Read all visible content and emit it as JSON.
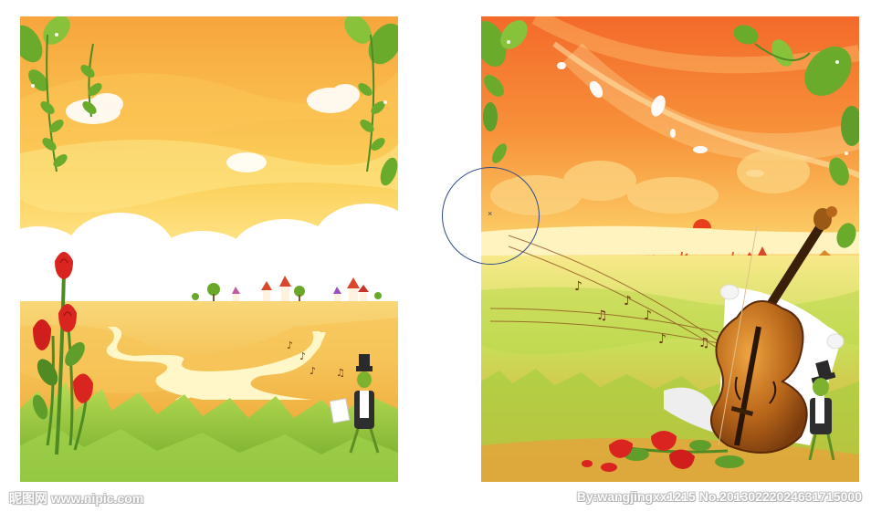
{
  "watermark": {
    "left_text": "昵图网 www.nipic.com",
    "right_text": "By:wangjingxx1215  No.20130222024631715000"
  },
  "panels": [
    {
      "name": "left-meadow-illustration",
      "icons": [
        "vine-icon",
        "rose-icon",
        "grasshopper-icon",
        "music-note-icon",
        "house-icon",
        "tree-icon",
        "cloud-icon"
      ]
    },
    {
      "name": "right-violin-illustration",
      "icons": [
        "vine-icon",
        "violin-icon",
        "sheet-music-icon",
        "rose-icon",
        "grasshopper-icon",
        "music-note-icon",
        "sun-icon",
        "house-icon"
      ]
    }
  ],
  "colors": {
    "sky_top": "#f8a53a",
    "sky_bottom": "#fff6b0",
    "grass": "#9bcb3c",
    "rose": "#d9241f",
    "leaf": "#5f9e2a",
    "violin": "#b8661a",
    "selection_circle": "#2f4a8a"
  }
}
